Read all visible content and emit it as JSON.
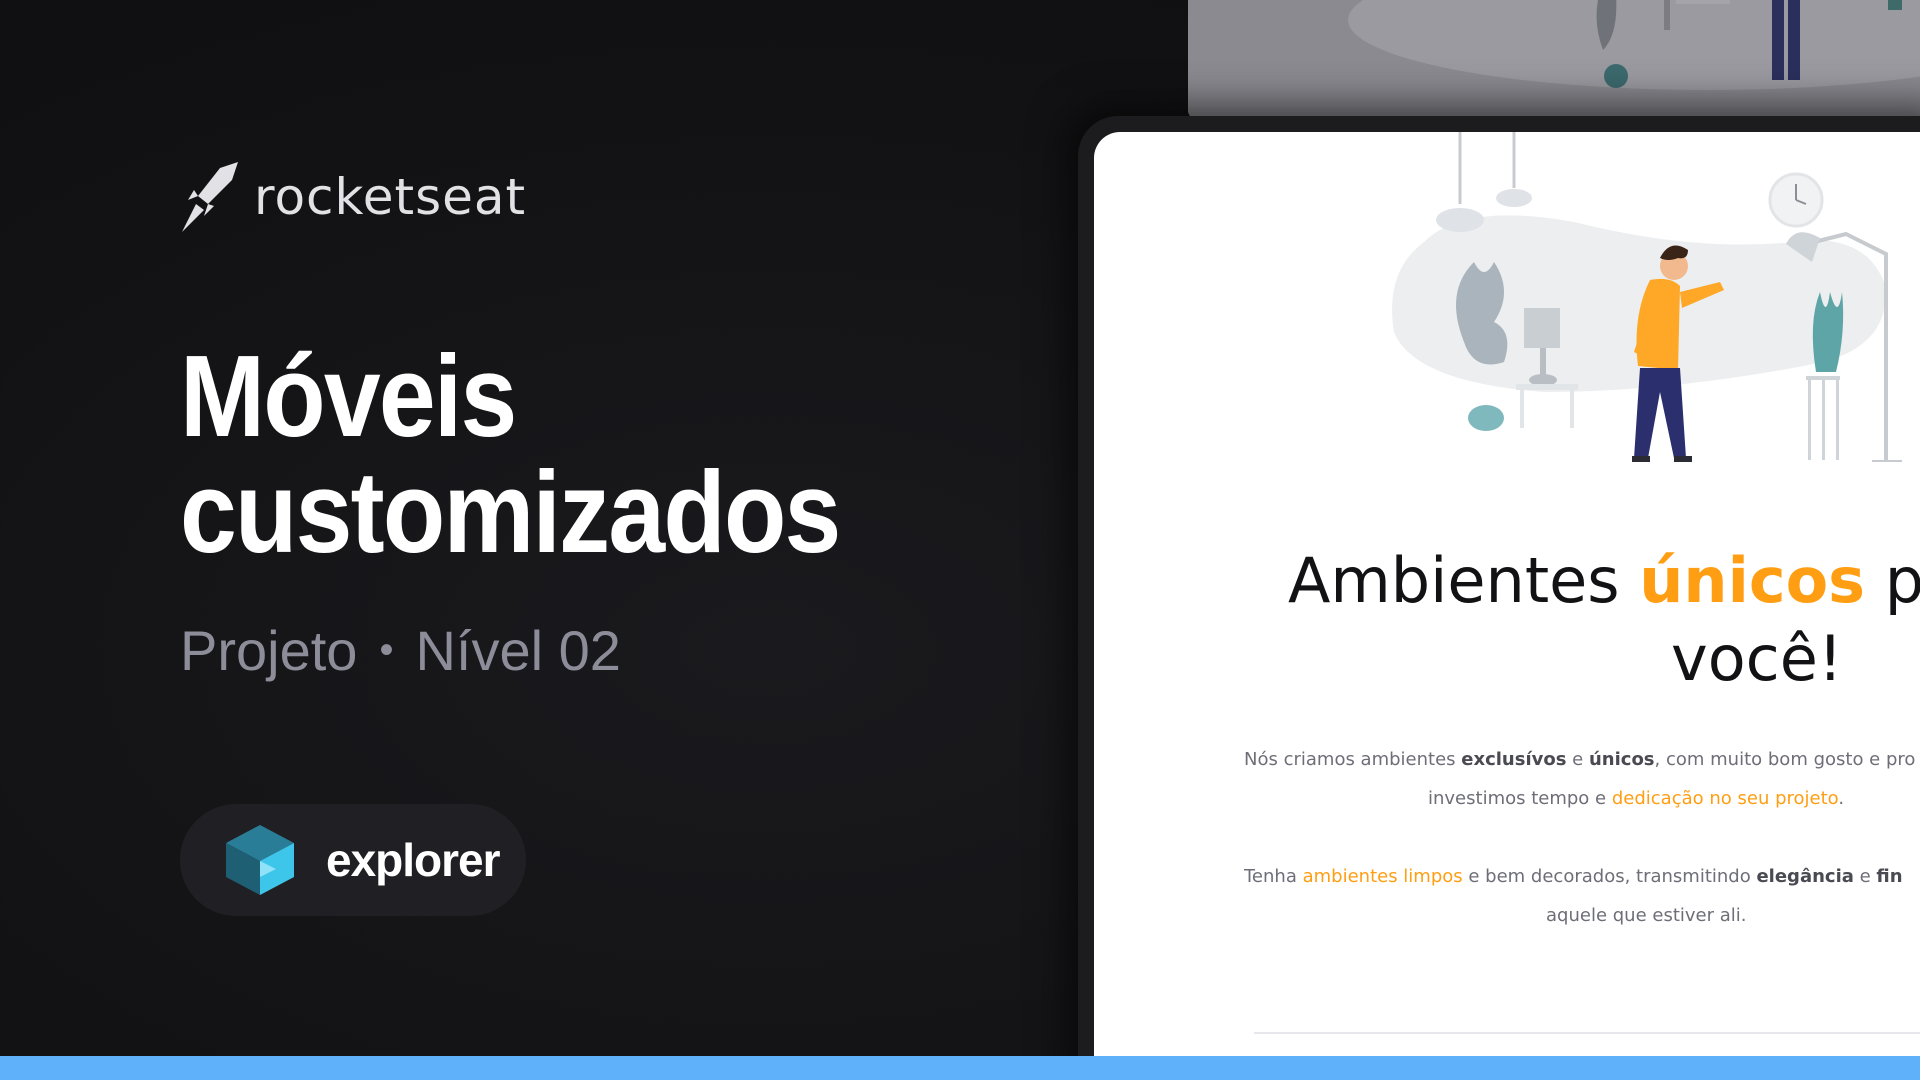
{
  "brand": {
    "name": "rocketseat",
    "logo_icon": "rocket-icon"
  },
  "title": {
    "line1": "Móveis",
    "line2": "customizados"
  },
  "subtitle": {
    "project": "Projeto",
    "separator": "•",
    "level": "Nível 02"
  },
  "badge": {
    "label": "explorer",
    "icon": "explorer-cube-icon"
  },
  "preview": {
    "headline": {
      "part1": "Ambientes ",
      "accent": "únicos",
      "part2": " p",
      "line2": "você!"
    },
    "paragraph1": {
      "t1": "Nós criamos ambientes ",
      "b1": "exclusívos",
      "t2": " e ",
      "b2": "únicos",
      "t3": ", com muito bom gosto e pro",
      "t4": "investimos tempo e ",
      "hl1": "dedicação no seu projeto",
      "t5": "."
    },
    "paragraph2": {
      "t1": "Tenha ",
      "hl1": "ambientes limpos",
      "t2": " e bem decorados, transmitindo ",
      "b1": "elegância",
      "t3": "  e ",
      "b2": "fin",
      "t4": "aquele que estiver ali."
    }
  },
  "colors": {
    "accent": "#ff9e12",
    "bar": "#5fb2fa",
    "background": "#121214"
  }
}
